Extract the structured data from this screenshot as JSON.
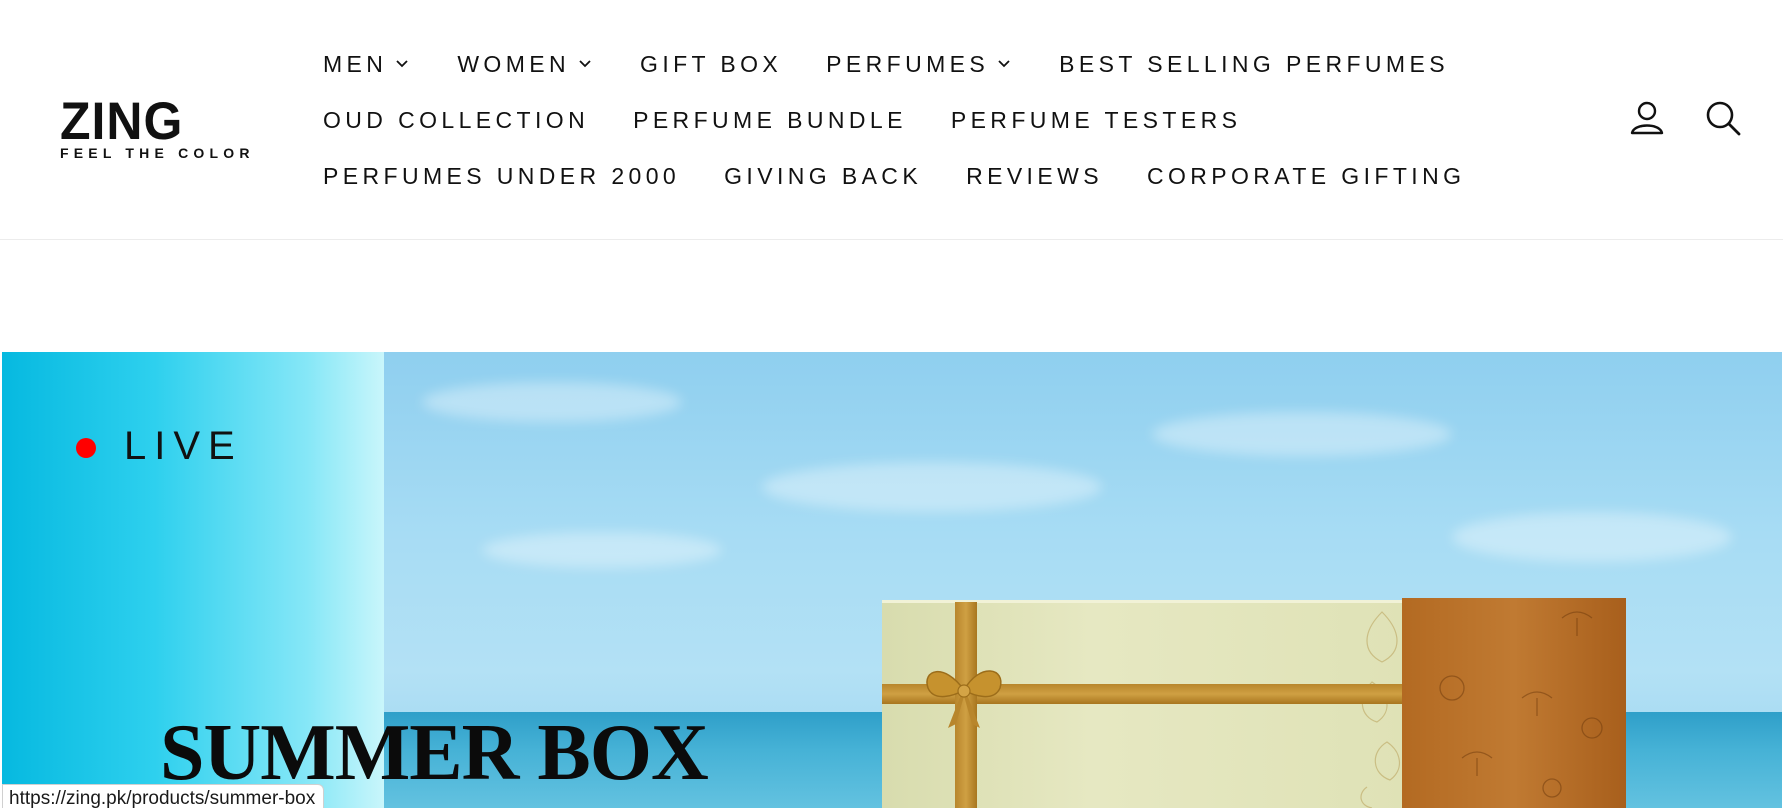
{
  "brand": {
    "name": "ZING",
    "tagline": "FEEL THE COLOR"
  },
  "nav": {
    "rows": [
      [
        {
          "label": "MEN",
          "has_dropdown": true
        },
        {
          "label": "WOMEN",
          "has_dropdown": true
        },
        {
          "label": "GIFT BOX",
          "has_dropdown": false
        },
        {
          "label": "PERFUMES",
          "has_dropdown": true
        },
        {
          "label": "BEST SELLING PERFUMES",
          "has_dropdown": false
        }
      ],
      [
        {
          "label": "OUD COLLECTION",
          "has_dropdown": false
        },
        {
          "label": "PERFUME BUNDLE",
          "has_dropdown": false
        },
        {
          "label": "PERFUME TESTERS",
          "has_dropdown": false
        }
      ],
      [
        {
          "label": "PERFUMES UNDER 2000",
          "has_dropdown": false
        },
        {
          "label": "GIVING BACK",
          "has_dropdown": false
        },
        {
          "label": "REVIEWS",
          "has_dropdown": false
        },
        {
          "label": "CORPORATE GIFTING",
          "has_dropdown": false
        }
      ]
    ]
  },
  "header_icons": {
    "account": "user-icon",
    "search": "search-icon"
  },
  "hero": {
    "live_label": "LIVE",
    "title": "SUMMER BOX",
    "live_dot_color": "#ff0000"
  },
  "status_bar": {
    "url": "https://zing.pk/products/summer-box"
  }
}
